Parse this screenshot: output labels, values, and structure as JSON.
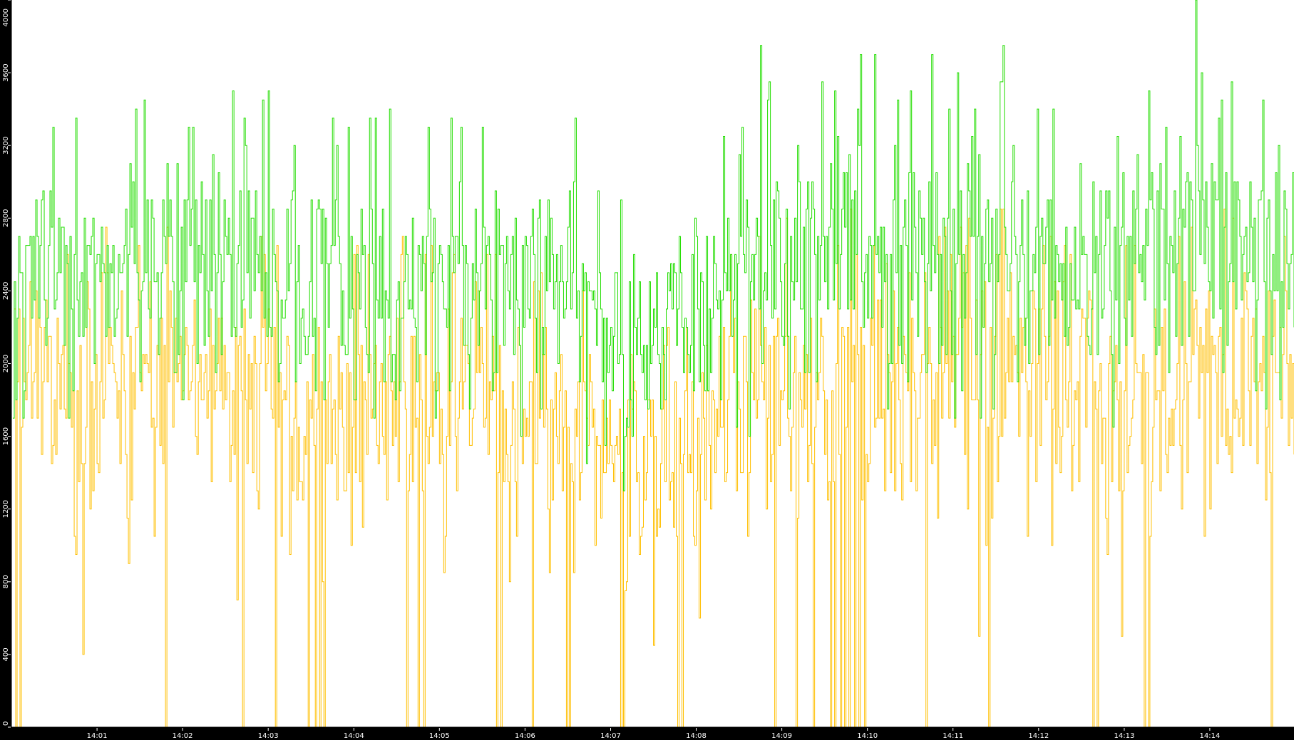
{
  "chart_data": {
    "type": "line",
    "title": "",
    "xlabel": "",
    "ylabel": "",
    "x_tick_labels": [
      "14:01",
      "14:02",
      "14:03",
      "14:04",
      "14:05",
      "14:06",
      "14:07",
      "14:08",
      "14:09",
      "14:10",
      "14:11",
      "14:12",
      "14:13",
      "14:14"
    ],
    "y_tick_labels": [
      "0",
      "400",
      "800",
      "1200",
      "1600",
      "2000",
      "2400",
      "2800",
      "3200",
      "3600",
      "4000"
    ],
    "x_range": [
      "14:00:01",
      "14:14:59"
    ],
    "ylim": [
      0,
      4000
    ],
    "grid": false,
    "legend": "none",
    "sample_interval_seconds": 1,
    "series": [
      {
        "color": "#22dd00",
        "profile_time": [
          "14:00:00",
          "14:00:30",
          "14:01:00",
          "14:01:30",
          "14:02:00",
          "14:02:30",
          "14:03:00",
          "14:03:30",
          "14:04:00",
          "14:04:30",
          "14:05:00",
          "14:05:30",
          "14:06:00",
          "14:06:30",
          "14:07:00",
          "14:07:30",
          "14:08:00",
          "14:08:30",
          "14:09:00",
          "14:09:30",
          "14:10:00",
          "14:10:30",
          "14:11:00",
          "14:11:30",
          "14:12:00",
          "14:12:30",
          "14:13:00",
          "14:13:30",
          "14:14:00",
          "14:14:30",
          "14:15:00"
        ],
        "profile_low": [
          1400,
          1650,
          1700,
          1500,
          1650,
          1700,
          1600,
          1550,
          1650,
          1600,
          1550,
          1650,
          1500,
          1450,
          1300,
          1250,
          1300,
          1500,
          1700,
          1600,
          1600,
          1750,
          1700,
          1650,
          1650,
          1700,
          1650,
          1700,
          1750,
          1700,
          1650
        ],
        "profile_high": [
          3150,
          3250,
          3200,
          3250,
          3300,
          3250,
          3300,
          3150,
          3200,
          3300,
          3250,
          3250,
          3200,
          3150,
          2800,
          2800,
          2900,
          3300,
          3350,
          3400,
          3450,
          3400,
          3400,
          3400,
          3350,
          3300,
          3350,
          3400,
          3550,
          3400,
          3300
        ],
        "peaks": [
          {
            "time": "14:13:50",
            "value": 4000
          },
          {
            "time": "14:08:45",
            "value": 3750
          },
          {
            "time": "14:11:35",
            "value": 3750
          },
          {
            "time": "14:09:55",
            "value": 3680
          },
          {
            "time": "14:10:05",
            "value": 3680
          },
          {
            "time": "14:10:45",
            "value": 3680
          },
          {
            "time": "14:02:35",
            "value": 3480
          },
          {
            "time": "14:03:00",
            "value": 3480
          },
          {
            "time": "14:00:45",
            "value": 3350
          },
          {
            "time": "14:06:35",
            "value": 3340
          },
          {
            "time": "14:14:15",
            "value": 3550
          }
        ]
      },
      {
        "color": "#ffbf00",
        "profile_time": [
          "14:00:00",
          "14:00:30",
          "14:01:00",
          "14:01:30",
          "14:02:00",
          "14:02:30",
          "14:03:00",
          "14:03:30",
          "14:04:00",
          "14:04:30",
          "14:05:00",
          "14:05:30",
          "14:06:00",
          "14:06:30",
          "14:07:00",
          "14:07:30",
          "14:08:00",
          "14:08:30",
          "14:09:00",
          "14:09:30",
          "14:10:00",
          "14:10:30",
          "14:11:00",
          "14:11:30",
          "14:12:00",
          "14:12:30",
          "14:13:00",
          "14:13:30",
          "14:14:00",
          "14:14:30",
          "14:15:00"
        ],
        "profile_low": [
          900,
          1000,
          850,
          900,
          1000,
          900,
          950,
          700,
          950,
          900,
          850,
          950,
          800,
          800,
          700,
          750,
          700,
          1000,
          1000,
          800,
          800,
          1000,
          950,
          1000,
          950,
          1000,
          950,
          1000,
          1050,
          1000,
          950
        ],
        "profile_high": [
          2700,
          2600,
          2600,
          2550,
          2600,
          2500,
          2550,
          2450,
          2500,
          2550,
          2500,
          2550,
          2400,
          2350,
          2050,
          2050,
          2100,
          2600,
          2650,
          2700,
          2750,
          2650,
          2700,
          2650,
          2600,
          2550,
          2600,
          2650,
          2800,
          2650,
          2600
        ],
        "zero_dips": [
          "14:00:03",
          "14:00:06",
          "14:01:48",
          "14:02:42",
          "14:03:05",
          "14:03:28",
          "14:03:33",
          "14:03:36",
          "14:03:39",
          "14:04:37",
          "14:04:45",
          "14:04:49",
          "14:05:40",
          "14:05:43",
          "14:06:05",
          "14:06:29",
          "14:06:31",
          "14:07:07",
          "14:07:09",
          "14:07:47",
          "14:07:50",
          "14:08:55",
          "14:09:10",
          "14:09:22",
          "14:09:34",
          "14:09:37",
          "14:09:41",
          "14:09:44",
          "14:09:47",
          "14:09:51",
          "14:09:54",
          "14:09:58",
          "14:10:41",
          "14:11:25",
          "14:12:38",
          "14:12:41",
          "14:12:58",
          "14:13:14",
          "14:13:17",
          "14:14:43"
        ],
        "low_dips": [
          {
            "time": "14:00:50",
            "value": 400
          },
          {
            "time": "14:02:38",
            "value": 700
          },
          {
            "time": "14:05:49",
            "value": 800
          },
          {
            "time": "14:07:30",
            "value": 450
          },
          {
            "time": "14:08:02",
            "value": 600
          },
          {
            "time": "14:11:18",
            "value": 480
          },
          {
            "time": "14:12:58",
            "value": 500
          }
        ]
      }
    ]
  }
}
